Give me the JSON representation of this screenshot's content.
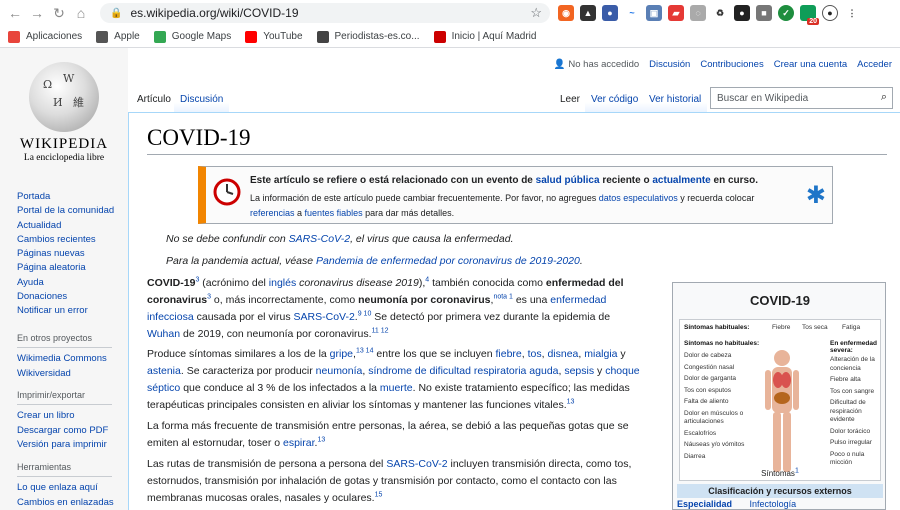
{
  "browser": {
    "url": "es.wikipedia.org/wiki/COVID-19",
    "bookmarks": [
      {
        "label": "Aplicaciones",
        "icon": "apps-grid-icon",
        "color": "#e8453c"
      },
      {
        "label": "Apple",
        "icon": "apple-icon",
        "color": "#555555"
      },
      {
        "label": "Google Maps",
        "icon": "maps-pin-icon",
        "color": "#34a853"
      },
      {
        "label": "YouTube",
        "icon": "youtube-icon",
        "color": "#ff0000"
      },
      {
        "label": "Periodistas-es.co...",
        "icon": "page-icon",
        "color": "#444444"
      },
      {
        "label": "Inicio | Aquí Madrid",
        "icon": "page-icon",
        "color": "#cc0000"
      }
    ],
    "extension_badge": "20"
  },
  "logo": {
    "wordmark": "Wikipedia",
    "tagline": "La enciclopedia libre"
  },
  "personal": {
    "not_logged": "No has accedido",
    "discussion": "Discusión",
    "contributions": "Contribuciones",
    "create": "Crear una cuenta",
    "login": "Acceder"
  },
  "sidebar": {
    "main": [
      "Portada",
      "Portal de la comunidad",
      "Actualidad",
      "Cambios recientes",
      "Páginas nuevas",
      "Página aleatoria",
      "Ayuda",
      "Donaciones",
      "Notificar un error"
    ],
    "projects_heading": "En otros proyectos",
    "projects": [
      "Wikimedia Commons",
      "Wikiversidad"
    ],
    "print_heading": "Imprimir/exportar",
    "print": [
      "Crear un libro",
      "Descargar como PDF",
      "Versión para imprimir"
    ],
    "tools_heading": "Herramientas",
    "tools": [
      "Lo que enlaza aquí",
      "Cambios en enlazadas"
    ]
  },
  "tabs": {
    "article": "Artículo",
    "talk": "Discusión",
    "read": "Leer",
    "source": "Ver código",
    "history": "Ver historial"
  },
  "search": {
    "placeholder": "Buscar en Wikipedia"
  },
  "page": {
    "title": "COVID-19",
    "notice_title_a": "Este artículo se refiere o está relacionado con un evento de ",
    "notice_link1": "salud pública",
    "notice_title_b": " reciente o ",
    "notice_link2": "actualmente",
    "notice_title_c": " en curso.",
    "notice_body_a": "La información de este artículo puede cambiar frecuentemente. Por favor, no agregues ",
    "notice_link3": "datos especulativos",
    "notice_body_b": " y recuerda colocar ",
    "notice_link4": "referencias",
    "notice_body_c": " a ",
    "notice_link5": "fuentes fiables",
    "notice_body_d": " para dar más detalles.",
    "hat1_a": "No se debe confundir con ",
    "hat1_link": "SARS-CoV-2",
    "hat1_b": ", el virus que causa la enfermedad.",
    "hat2_a": "Para la pandemia actual, véase ",
    "hat2_link": "Pandemia de enfermedad por coronavirus de 2019-2020",
    "hat2_b": "."
  },
  "infobox": {
    "title": "COVID-19",
    "hab_label": "Síntomas habituales:",
    "hab": [
      "Fiebre",
      "Tos seca",
      "Fatiga"
    ],
    "nohab_label": "Síntomas no habituales:",
    "nohab": [
      "Dolor de cabeza",
      "Congestión nasal",
      "Dolor de garganta",
      "Tos con esputos",
      "Falta de aliento",
      "Dolor en músculos o articulaciones",
      "Escalofríos",
      "Náuseas y/o vómitos",
      "Diarrea"
    ],
    "severe_label": "En enfermedad severa:",
    "severe": [
      "Alteración de la conciencia",
      "Fiebre alta",
      "Tos con sangre",
      "Dificultad de respiración evidente",
      "Dolor torácico",
      "Pulso irregular",
      "Poco o nula micción"
    ],
    "caption": "Síntomas",
    "section": "Clasificación y recursos externos",
    "row_label": "Especialidad",
    "row_value": "Infectología"
  }
}
